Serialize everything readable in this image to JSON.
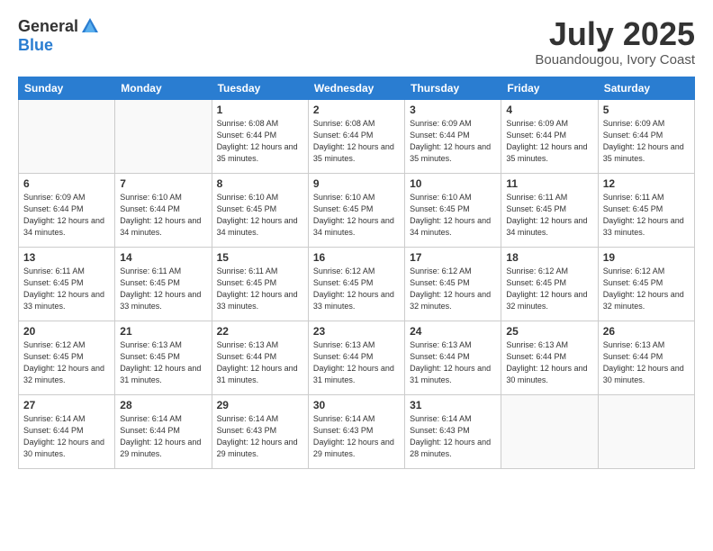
{
  "logo": {
    "general": "General",
    "blue": "Blue"
  },
  "title": "July 2025",
  "subtitle": "Bouandougou, Ivory Coast",
  "weekdays": [
    "Sunday",
    "Monday",
    "Tuesday",
    "Wednesday",
    "Thursday",
    "Friday",
    "Saturday"
  ],
  "weeks": [
    [
      {
        "day": "",
        "sunrise": "",
        "sunset": "",
        "daylight": ""
      },
      {
        "day": "",
        "sunrise": "",
        "sunset": "",
        "daylight": ""
      },
      {
        "day": "1",
        "sunrise": "Sunrise: 6:08 AM",
        "sunset": "Sunset: 6:44 PM",
        "daylight": "Daylight: 12 hours and 35 minutes."
      },
      {
        "day": "2",
        "sunrise": "Sunrise: 6:08 AM",
        "sunset": "Sunset: 6:44 PM",
        "daylight": "Daylight: 12 hours and 35 minutes."
      },
      {
        "day": "3",
        "sunrise": "Sunrise: 6:09 AM",
        "sunset": "Sunset: 6:44 PM",
        "daylight": "Daylight: 12 hours and 35 minutes."
      },
      {
        "day": "4",
        "sunrise": "Sunrise: 6:09 AM",
        "sunset": "Sunset: 6:44 PM",
        "daylight": "Daylight: 12 hours and 35 minutes."
      },
      {
        "day": "5",
        "sunrise": "Sunrise: 6:09 AM",
        "sunset": "Sunset: 6:44 PM",
        "daylight": "Daylight: 12 hours and 35 minutes."
      }
    ],
    [
      {
        "day": "6",
        "sunrise": "Sunrise: 6:09 AM",
        "sunset": "Sunset: 6:44 PM",
        "daylight": "Daylight: 12 hours and 34 minutes."
      },
      {
        "day": "7",
        "sunrise": "Sunrise: 6:10 AM",
        "sunset": "Sunset: 6:44 PM",
        "daylight": "Daylight: 12 hours and 34 minutes."
      },
      {
        "day": "8",
        "sunrise": "Sunrise: 6:10 AM",
        "sunset": "Sunset: 6:45 PM",
        "daylight": "Daylight: 12 hours and 34 minutes."
      },
      {
        "day": "9",
        "sunrise": "Sunrise: 6:10 AM",
        "sunset": "Sunset: 6:45 PM",
        "daylight": "Daylight: 12 hours and 34 minutes."
      },
      {
        "day": "10",
        "sunrise": "Sunrise: 6:10 AM",
        "sunset": "Sunset: 6:45 PM",
        "daylight": "Daylight: 12 hours and 34 minutes."
      },
      {
        "day": "11",
        "sunrise": "Sunrise: 6:11 AM",
        "sunset": "Sunset: 6:45 PM",
        "daylight": "Daylight: 12 hours and 34 minutes."
      },
      {
        "day": "12",
        "sunrise": "Sunrise: 6:11 AM",
        "sunset": "Sunset: 6:45 PM",
        "daylight": "Daylight: 12 hours and 33 minutes."
      }
    ],
    [
      {
        "day": "13",
        "sunrise": "Sunrise: 6:11 AM",
        "sunset": "Sunset: 6:45 PM",
        "daylight": "Daylight: 12 hours and 33 minutes."
      },
      {
        "day": "14",
        "sunrise": "Sunrise: 6:11 AM",
        "sunset": "Sunset: 6:45 PM",
        "daylight": "Daylight: 12 hours and 33 minutes."
      },
      {
        "day": "15",
        "sunrise": "Sunrise: 6:11 AM",
        "sunset": "Sunset: 6:45 PM",
        "daylight": "Daylight: 12 hours and 33 minutes."
      },
      {
        "day": "16",
        "sunrise": "Sunrise: 6:12 AM",
        "sunset": "Sunset: 6:45 PM",
        "daylight": "Daylight: 12 hours and 33 minutes."
      },
      {
        "day": "17",
        "sunrise": "Sunrise: 6:12 AM",
        "sunset": "Sunset: 6:45 PM",
        "daylight": "Daylight: 12 hours and 32 minutes."
      },
      {
        "day": "18",
        "sunrise": "Sunrise: 6:12 AM",
        "sunset": "Sunset: 6:45 PM",
        "daylight": "Daylight: 12 hours and 32 minutes."
      },
      {
        "day": "19",
        "sunrise": "Sunrise: 6:12 AM",
        "sunset": "Sunset: 6:45 PM",
        "daylight": "Daylight: 12 hours and 32 minutes."
      }
    ],
    [
      {
        "day": "20",
        "sunrise": "Sunrise: 6:12 AM",
        "sunset": "Sunset: 6:45 PM",
        "daylight": "Daylight: 12 hours and 32 minutes."
      },
      {
        "day": "21",
        "sunrise": "Sunrise: 6:13 AM",
        "sunset": "Sunset: 6:45 PM",
        "daylight": "Daylight: 12 hours and 31 minutes."
      },
      {
        "day": "22",
        "sunrise": "Sunrise: 6:13 AM",
        "sunset": "Sunset: 6:44 PM",
        "daylight": "Daylight: 12 hours and 31 minutes."
      },
      {
        "day": "23",
        "sunrise": "Sunrise: 6:13 AM",
        "sunset": "Sunset: 6:44 PM",
        "daylight": "Daylight: 12 hours and 31 minutes."
      },
      {
        "day": "24",
        "sunrise": "Sunrise: 6:13 AM",
        "sunset": "Sunset: 6:44 PM",
        "daylight": "Daylight: 12 hours and 31 minutes."
      },
      {
        "day": "25",
        "sunrise": "Sunrise: 6:13 AM",
        "sunset": "Sunset: 6:44 PM",
        "daylight": "Daylight: 12 hours and 30 minutes."
      },
      {
        "day": "26",
        "sunrise": "Sunrise: 6:13 AM",
        "sunset": "Sunset: 6:44 PM",
        "daylight": "Daylight: 12 hours and 30 minutes."
      }
    ],
    [
      {
        "day": "27",
        "sunrise": "Sunrise: 6:14 AM",
        "sunset": "Sunset: 6:44 PM",
        "daylight": "Daylight: 12 hours and 30 minutes."
      },
      {
        "day": "28",
        "sunrise": "Sunrise: 6:14 AM",
        "sunset": "Sunset: 6:44 PM",
        "daylight": "Daylight: 12 hours and 29 minutes."
      },
      {
        "day": "29",
        "sunrise": "Sunrise: 6:14 AM",
        "sunset": "Sunset: 6:43 PM",
        "daylight": "Daylight: 12 hours and 29 minutes."
      },
      {
        "day": "30",
        "sunrise": "Sunrise: 6:14 AM",
        "sunset": "Sunset: 6:43 PM",
        "daylight": "Daylight: 12 hours and 29 minutes."
      },
      {
        "day": "31",
        "sunrise": "Sunrise: 6:14 AM",
        "sunset": "Sunset: 6:43 PM",
        "daylight": "Daylight: 12 hours and 28 minutes."
      },
      {
        "day": "",
        "sunrise": "",
        "sunset": "",
        "daylight": ""
      },
      {
        "day": "",
        "sunrise": "",
        "sunset": "",
        "daylight": ""
      }
    ]
  ]
}
